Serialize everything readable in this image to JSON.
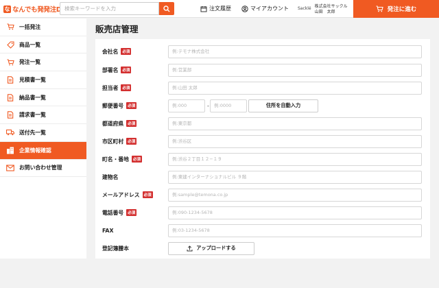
{
  "header": {
    "logo_mark": "な",
    "logo_text": "なんでも発発注DX",
    "search_placeholder": "検索キーワードを入力",
    "order_history": "注文履歴",
    "my_account": "マイアカウント",
    "company_logo_text": "Sacklé",
    "company_name": "株式会社サックル",
    "user_name": "山田　太郎",
    "proceed_label": "発注に進む"
  },
  "sidebar": {
    "items": [
      {
        "label": "一括発注",
        "icon": "cart-icon"
      },
      {
        "label": "商品一覧",
        "icon": "tag-icon"
      },
      {
        "label": "発注一覧",
        "icon": "cart-icon"
      },
      {
        "label": "見積書一覧",
        "icon": "document-icon"
      },
      {
        "label": "納品書一覧",
        "icon": "document-icon"
      },
      {
        "label": "請求書一覧",
        "icon": "document-icon"
      },
      {
        "label": "送付先一覧",
        "icon": "truck-icon"
      },
      {
        "label": "企業情報確認",
        "icon": "building-icon",
        "active": true
      },
      {
        "label": "お問い合わせ管理",
        "icon": "mail-icon"
      }
    ]
  },
  "main": {
    "title": "販売店管理",
    "required_label": "必須",
    "fields": {
      "company_name": {
        "label": "会社名",
        "placeholder": "例:テモナ株式会社"
      },
      "department": {
        "label": "部署名",
        "placeholder": "例:営業部"
      },
      "person": {
        "label": "担当者",
        "placeholder": "例:山田 太郎"
      },
      "postal": {
        "label": "郵便番号",
        "placeholder1": "例:000",
        "separator": "-",
        "placeholder2": "例:0000",
        "auto_button": "住所を自動入力"
      },
      "prefecture": {
        "label": "都道府県",
        "placeholder": "例:東京都"
      },
      "city": {
        "label": "市区町村",
        "placeholder": "例:渋谷区"
      },
      "street": {
        "label": "町名・番地",
        "placeholder": "例:渋谷２丁目１２−１９"
      },
      "building": {
        "label": "建物名",
        "placeholder": "例:東建インターナショナルビル ９階"
      },
      "email": {
        "label": "メールアドレス",
        "placeholder": "例:sample@temona.co.jp"
      },
      "phone": {
        "label": "電話番号",
        "placeholder": "例:090-1234-5678"
      },
      "fax": {
        "label": "FAX",
        "placeholder": "例:03-1234-5678"
      },
      "registry": {
        "label": "登記簿謄本",
        "upload_button": "アップロードする"
      }
    }
  },
  "colors": {
    "accent": "#f05a22",
    "required": "#d32f2f"
  }
}
